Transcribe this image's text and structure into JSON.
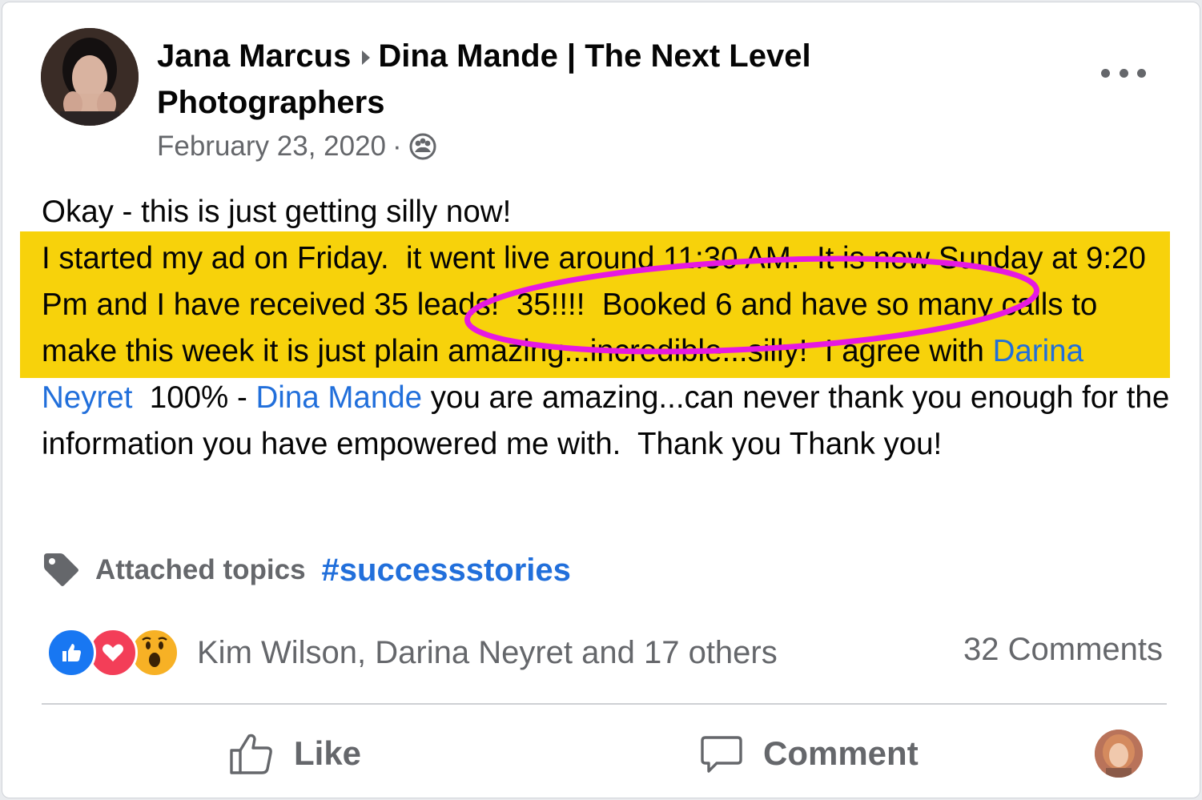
{
  "post": {
    "author": "Jana Marcus",
    "group": "Dina Mande | The Next Level Photographers",
    "date": "February 23, 2020",
    "dot": "·",
    "audience_icon": "group-audience-icon",
    "more_icon": "more-options-icon",
    "text": {
      "line1": "Okay - this is just getting silly now!",
      "para1": "I started my ad on Friday.  it went live around 11:30 AM.  It is now Sunday at 9:20 Pm and I have received 35 leads!  35!!!!  Booked 6 and have so many calls to make this week it is just plain amazing...incredible...silly!  I agree with ",
      "mention1": "Darina Neyret",
      "para2": "  100% - ",
      "mention2": "Dina Mande",
      "para3": " you are amazing...can never thank you enough for the information you have empowered me with.  Thank you Thank you!"
    },
    "highlight_color": "#f7d20b",
    "annotation_color": "#e619e1"
  },
  "topics": {
    "icon": "tag-icon",
    "label": "Attached topics",
    "tag": "#successstories"
  },
  "reactions": {
    "icons": [
      "like-reaction-icon",
      "love-reaction-icon",
      "wow-reaction-icon"
    ],
    "summary": "Kim Wilson, Darina Neyret and 17 others",
    "comments": "32 Comments"
  },
  "actions": {
    "like": "Like",
    "comment": "Comment"
  },
  "colors": {
    "link": "#216fdb",
    "secondary_text": "#65676b",
    "like_blue": "#1877f2"
  }
}
